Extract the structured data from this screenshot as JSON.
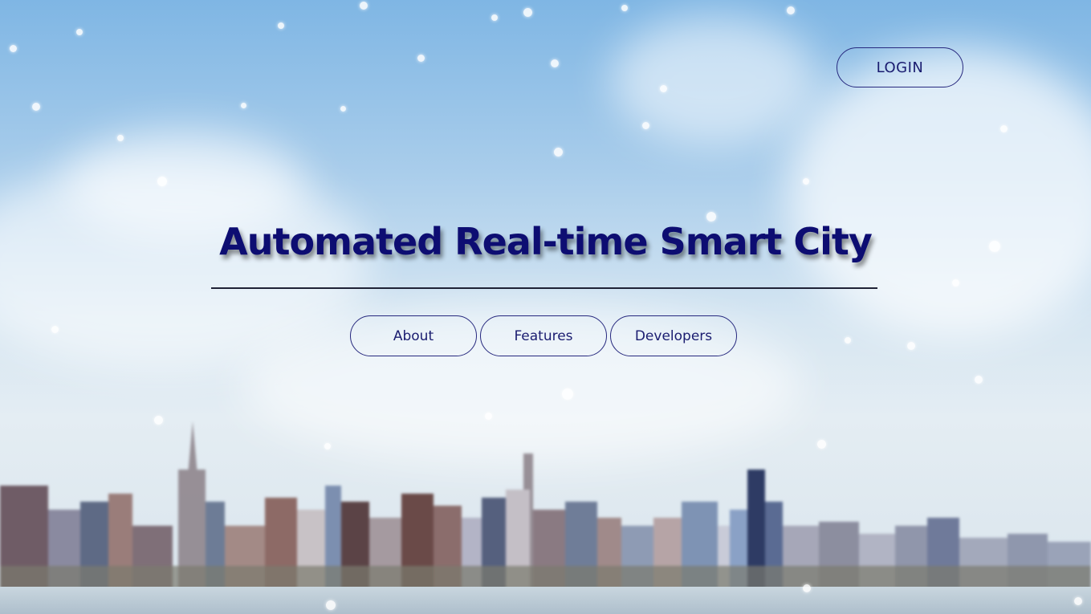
{
  "header": {
    "login_label": "LOGIN"
  },
  "hero": {
    "title": "Automated Real-time Smart City"
  },
  "nav": {
    "items": [
      {
        "label": "About"
      },
      {
        "label": "Features"
      },
      {
        "label": "Developers"
      }
    ]
  }
}
